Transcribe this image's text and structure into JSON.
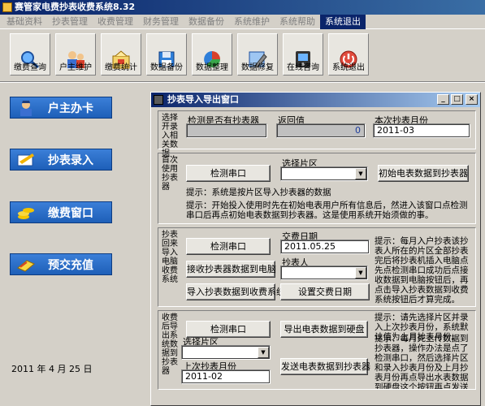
{
  "window": {
    "title": "赛管家电费抄表收费系统8.32"
  },
  "menu": [
    {
      "label": "基础资料"
    },
    {
      "label": "抄表管理"
    },
    {
      "label": "收费管理"
    },
    {
      "label": "财务管理"
    },
    {
      "label": "数据备份"
    },
    {
      "label": "系统维护"
    },
    {
      "label": "系统帮助"
    },
    {
      "label": "系统退出",
      "active": true
    }
  ],
  "toolbar": [
    {
      "label": "缴费查询",
      "icon": "payment-query-icon"
    },
    {
      "label": "户主维护",
      "icon": "owner-maintain-icon"
    },
    {
      "label": "缴费统计",
      "icon": "payment-stats-icon"
    },
    {
      "label": "数据备份",
      "icon": "data-backup-icon"
    },
    {
      "label": "数据整理",
      "icon": "data-organize-icon"
    },
    {
      "label": "数据修复",
      "icon": "data-repair-icon"
    },
    {
      "label": "在线咨询",
      "icon": "online-consult-icon"
    },
    {
      "label": "系统退出",
      "icon": "system-exit-icon"
    }
  ],
  "sidebar": [
    {
      "label": "户主办卡",
      "icon": "user-card-icon"
    },
    {
      "label": "抄表录入",
      "icon": "meter-input-icon"
    },
    {
      "label": "缴费窗口",
      "icon": "payment-window-icon"
    },
    {
      "label": "预交充值",
      "icon": "prepay-icon"
    }
  ],
  "status": {
    "date": "2011 年   4 月 25 日"
  },
  "dialog": {
    "title": "抄表导入导出窗口",
    "controls": {
      "minimize": "_",
      "maximize": "□",
      "close": "×"
    },
    "section1": {
      "label": "选择开录入相关数据",
      "detect_label": "检测是否有抄表器",
      "return_label": "返回值",
      "return_value": "0",
      "month_label": "本次抄表月份",
      "month_value": "2011-03"
    },
    "section2": {
      "label": "首次使用抄表器",
      "detect_button": "检测串口",
      "area_label": "选择片区",
      "area_value": "",
      "init_button": "初始电表数据到抄表器",
      "hint1": "提示：系统是按片区导入抄表器的数据",
      "hint2": "提示：开始投入使用时先在初始电表用户所有信息后，然进入该窗口点检测串口后再点初始电表数据到抄表器。这是使用系统开始须做的事。"
    },
    "section3": {
      "label": "抄表回来导入电脑收费系统",
      "detect_button": "检测串口",
      "receive_button": "接收抄表器数据到电脑",
      "import_button": "导入抄表数据到收费系统",
      "pay_date_label": "交费日期",
      "pay_date_value": "2011.05.25",
      "reader_label": "抄表人",
      "reader_value": "",
      "set_date_button": "设置交费日期",
      "hint": "提示：每月入户抄表该抄表人所在的片区全部抄表完后将抄表机插入电脑点先点检测串口成功后点接收数据到电脑按钮后，再点击导入抄表数据到收费系统按钮后才算完成。"
    },
    "section4": {
      "label": "收费后导出系统数据到抄表器",
      "detect_button": "检测串口",
      "area_label": "选择片区",
      "area_value": "",
      "month_label": "上次抄表月份",
      "month_value": "2011-02",
      "export_button": "导出电表数据到硬盘",
      "send_button": "发送电表数据到抄表器",
      "hint1": "提示：请先选择片区并录入上次抄表月份，系统默认值为上月抄表月份。",
      "hint2": "提示：每月先上传数据到抄表器，操作办法是点了检测串口，然后选择片区和录入抄表月份及上月抄表月份再点导出水表数据到硬盘这个按钮再点发送水表数据到抄表器这个按钮。"
    }
  }
}
